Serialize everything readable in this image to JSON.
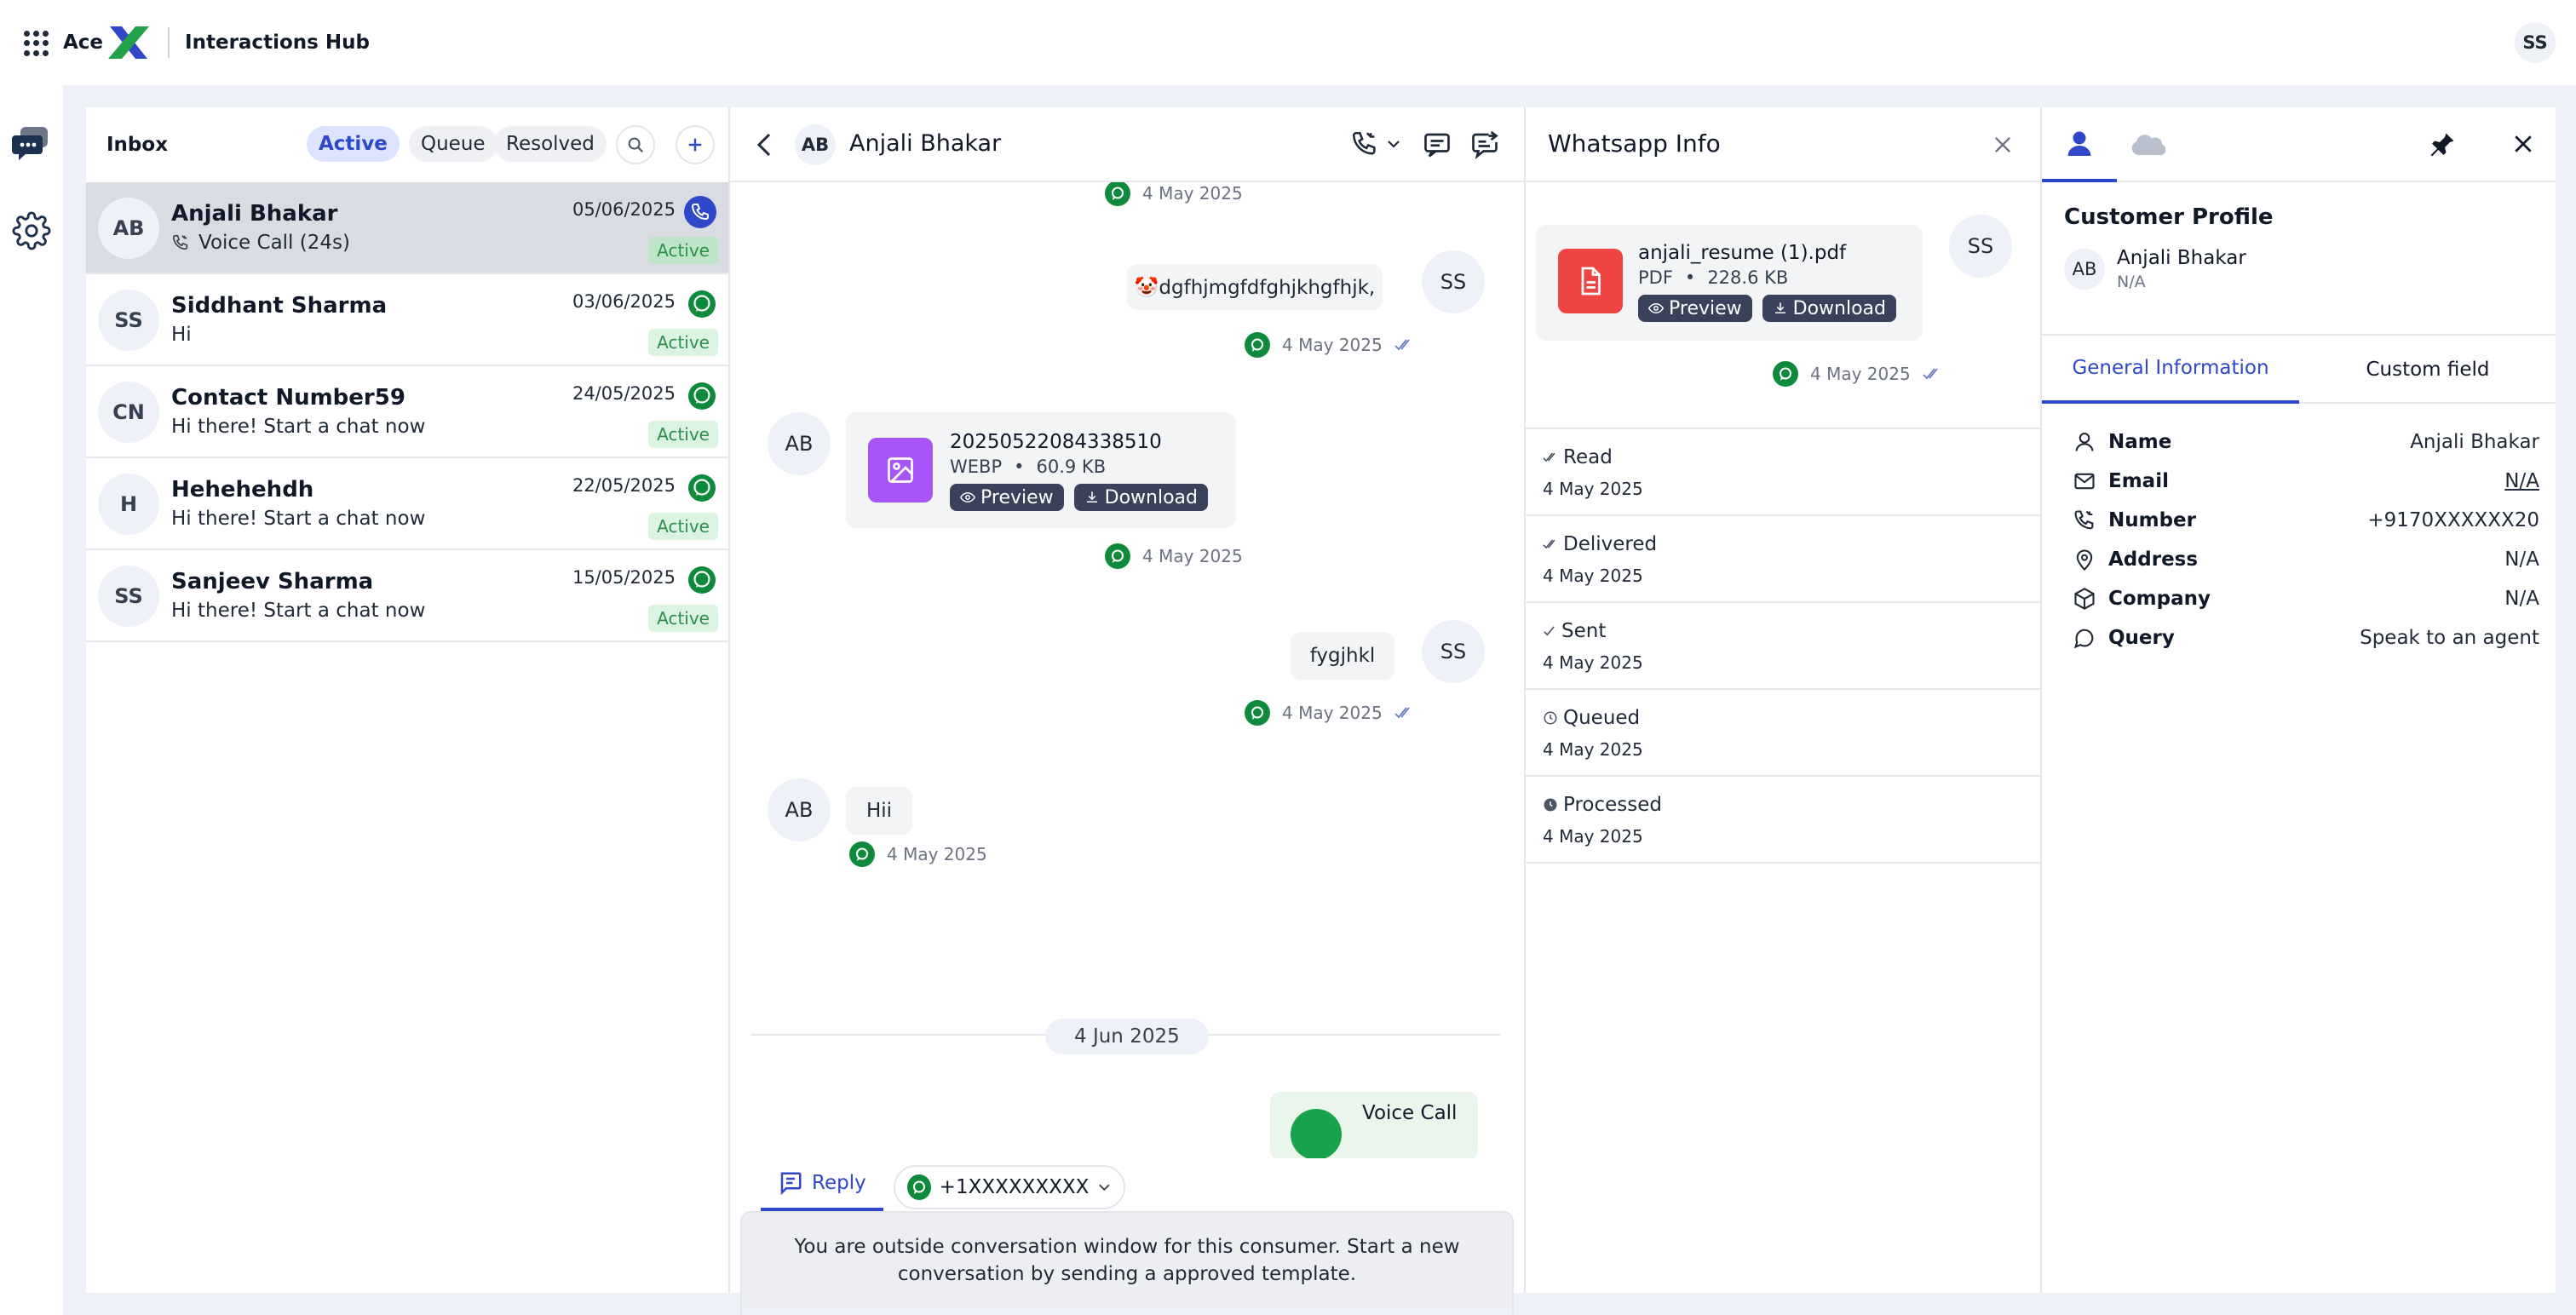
{
  "app": {
    "brand_name": "Ace",
    "product_name": "Interactions Hub",
    "user_initials": "SS",
    "brand_colors": {
      "primary": "#2f47c9",
      "brand_green": "#22a34a",
      "whatsapp_green": "#0e8a3c"
    }
  },
  "rail": {
    "items": [
      {
        "icon": "chat-bubbles-icon"
      },
      {
        "icon": "gear-icon"
      }
    ]
  },
  "inbox": {
    "title": "Inbox",
    "filters": [
      "Active",
      "Queue",
      "Resolved"
    ],
    "active_filter": "Active",
    "conversations": [
      {
        "initials": "AB",
        "name": "Anjali Bhakar",
        "preview": "Voice Call (24s)",
        "date": "05/06/2025",
        "status": "Active",
        "channel": "voice"
      },
      {
        "initials": "SS",
        "name": "Siddhant Sharma",
        "preview": "Hi",
        "date": "03/06/2025",
        "status": "Active",
        "channel": "whatsapp"
      },
      {
        "initials": "CN",
        "name": "Contact Number59",
        "preview": "Hi there! Start a chat now",
        "date": "24/05/2025",
        "status": "Active",
        "channel": "whatsapp"
      },
      {
        "initials": "H",
        "name": "Hehehehdh",
        "preview": "Hi there! Start a chat now",
        "date": "22/05/2025",
        "status": "Active",
        "channel": "whatsapp"
      },
      {
        "initials": "SS",
        "name": "Sanjeev Sharma",
        "preview": "Hi there! Start a chat now",
        "date": "15/05/2025",
        "status": "Active",
        "channel": "whatsapp"
      }
    ]
  },
  "chat": {
    "contact_initials": "AB",
    "contact_name": "Anjali Bhakar",
    "messages": {
      "top_time": "4 May 2025",
      "m1": {
        "initials": "SS",
        "text": "🤡dgfhjmgfdfghjkhgfhjk,",
        "time": "4 May 2025"
      },
      "m2": {
        "initials": "AB",
        "file_name": "20250522084338510",
        "file_type": "WEBP",
        "file_size": "60.9 KB",
        "preview": "Preview",
        "download": "Download",
        "time": "4 May 2025"
      },
      "m3": {
        "initials": "SS",
        "text": "fygjhkl",
        "time": "4 May 2025"
      },
      "m4": {
        "initials": "AB",
        "text": "Hii",
        "time": "4 May 2025"
      },
      "date_separator": "4 Jun 2025",
      "m5": {
        "text": "Voice Call"
      }
    },
    "reply_tab": "Reply",
    "from_number": "+1XXXXXXXXX",
    "window_notice": "You are outside conversation window for this consumer. Start a new conversation by sending a approved template."
  },
  "whatsapp_info": {
    "title": "Whatsapp Info",
    "message": {
      "initials": "SS",
      "file_name": "anjali_resume (1).pdf",
      "file_type": "PDF",
      "file_size": "228.6 KB",
      "preview": "Preview",
      "download": "Download",
      "time": "4 May 2025"
    },
    "statuses": [
      {
        "label": "Read",
        "time": "4 May 2025",
        "icon": "double-check-icon"
      },
      {
        "label": "Delivered",
        "time": "4 May 2025",
        "icon": "double-check-icon"
      },
      {
        "label": "Sent",
        "time": "4 May 2025",
        "icon": "check-icon"
      },
      {
        "label": "Queued",
        "time": "4 May 2025",
        "icon": "clock-icon"
      },
      {
        "label": "Processed",
        "time": "4 May 2025",
        "icon": "clock-filled-icon"
      }
    ]
  },
  "profile": {
    "section_title": "Customer Profile",
    "initials": "AB",
    "name": "Anjali Bhakar",
    "subtitle": "N/A",
    "tabs": [
      "General Information",
      "Custom field"
    ],
    "active_tab": "General Information",
    "fields": [
      {
        "label": "Name",
        "value": "Anjali Bhakar",
        "icon": "user-icon"
      },
      {
        "label": "Email",
        "value": "N/A",
        "icon": "mail-icon"
      },
      {
        "label": "Number",
        "value": "+9170XXXXXX20",
        "icon": "phone-icon"
      },
      {
        "label": "Address",
        "value": "N/A",
        "icon": "location-pin-icon"
      },
      {
        "label": "Company",
        "value": "N/A",
        "icon": "box-icon"
      },
      {
        "label": "Query",
        "value": "Speak to an agent",
        "icon": "speech-bubble-icon"
      }
    ]
  }
}
